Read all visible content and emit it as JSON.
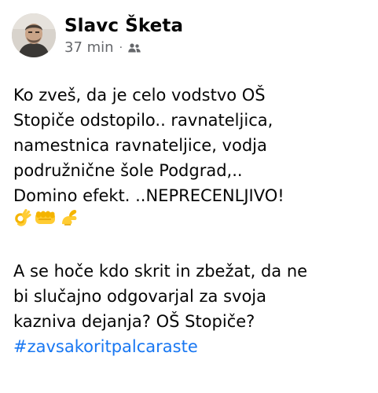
{
  "post": {
    "author": "Slavc Šketa",
    "time": "37 min",
    "separator": "·",
    "audience_icon": "friends-icon",
    "paragraph1": [
      "Ko zveš, da je celo vodstvo OŠ",
      "Stopiče odstopilo.. ravnateljica,",
      "namestnica ravnateljice, vodja",
      "podružnične šole Podgrad,..",
      "Domino efekt. ..NEPRECENLJIVO!"
    ],
    "emojis": [
      "ok-hand-emoji",
      "oncoming-fist-emoji",
      "pinching-hand-emoji"
    ],
    "paragraph2": [
      "A se hoče kdo skrit in zbežat, da ne",
      "bi slučajno odgovarjal za svoja",
      "kazniva dejanja? OŠ Stopiče?"
    ],
    "hashtag": "#zavsakoritpalcaraste"
  },
  "colors": {
    "text": "#050505",
    "secondary": "#65676b",
    "link": "#1877f2",
    "emoji_yellow": "#ffcc33"
  }
}
